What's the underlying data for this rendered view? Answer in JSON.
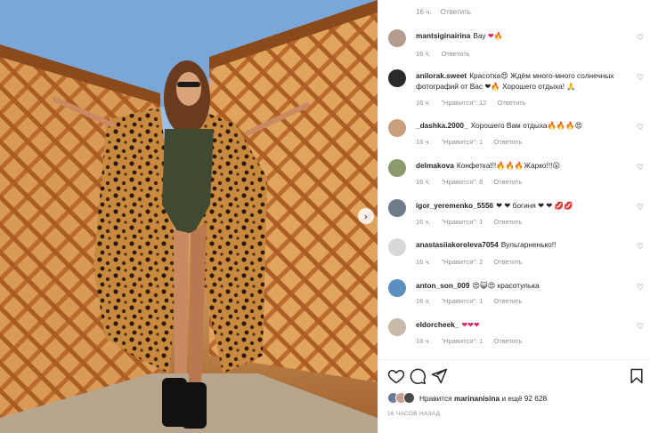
{
  "top_meta": {
    "time": "16 ч.",
    "reply": "Ответить"
  },
  "comments": [
    {
      "user": "mantsiginairina",
      "text": "Вау",
      "emoji": "❤🔥",
      "time": "16 ч.",
      "likes": "",
      "reply": "Ответить",
      "avatar_color": "#b39c8e"
    },
    {
      "user": "anilorak.sweet",
      "text": "Красотка😍 Ждём много-много солнечных фотографий от Вас ❤🔥 Хорошего отдыха! 🙏",
      "emoji": "",
      "time": "16 ч.",
      "likes": "\"Нравится\": 12",
      "reply": "Ответить",
      "avatar_color": "#2a2a2a"
    },
    {
      "user": "_dashka.2000_",
      "text": "Хорошего Вам отдыха🔥🔥🔥😍",
      "emoji": "",
      "time": "16 ч.",
      "likes": "\"Нравится\": 1",
      "reply": "Ответить",
      "avatar_color": "#c9a07e"
    },
    {
      "user": "delmakova",
      "text": "Конфетка!!!🔥🔥🔥Жарко!!!😮",
      "emoji": "",
      "time": "16 ч.",
      "likes": "\"Нравится\": 6",
      "reply": "Ответить",
      "avatar_color": "#8a9a6a"
    },
    {
      "user": "igor_yeremenko_5556",
      "text": "❤ ❤  богиня ❤ ❤ 💋💋",
      "emoji": "",
      "time": "16 ч.",
      "likes": "\"Нравится\": 1",
      "reply": "Ответить",
      "avatar_color": "#6d7b8a"
    },
    {
      "user": "anastasiiakoroleva7054",
      "text": "Вульгарненько!!",
      "emoji": "",
      "time": "16 ч.",
      "likes": "\"Нравится\": 2",
      "reply": "Ответить",
      "avatar_color": "#d8d8d8"
    },
    {
      "user": "anton_son_009",
      "text": "😍😺😍 красотулька",
      "emoji": "",
      "time": "16 ч.",
      "likes": "\"Нравится\": 1",
      "reply": "Ответить",
      "avatar_color": "#5c8fc0"
    },
    {
      "user": "eldorcheek_",
      "text": "❤❤❤",
      "emoji": "",
      "time": "16 ч.",
      "likes": "\"Нравится\": 1",
      "reply": "Ответить",
      "avatar_color": "#c8b8a8"
    }
  ],
  "likes": {
    "prefix": "Нравится",
    "user": "marinanisina",
    "suffix": "и ещё 92 628"
  },
  "time_ago": "16 ЧАСОВ НАЗАД",
  "icons": {
    "like": "heart-icon",
    "comment": "comment-icon",
    "share": "paper-plane-icon",
    "save": "bookmark-icon",
    "next": "chevron-right-icon"
  },
  "colors": {
    "text": "#262626",
    "muted": "#8e8e8e",
    "divider": "#efefef",
    "emoji_heart": "#e0245e"
  }
}
